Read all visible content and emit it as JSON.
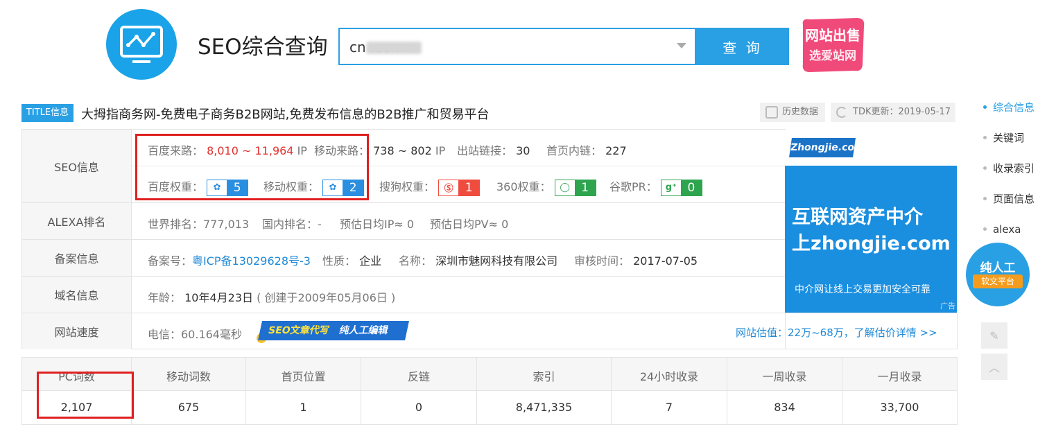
{
  "header": {
    "title": "SEO综合查询",
    "search_value": "cn          .com",
    "search_button": "查 询",
    "sale_badge_line1": "网站出售",
    "sale_badge_line2": "选爱站网"
  },
  "title_row": {
    "tag": "TITLE信息",
    "text": "大拇指商务网-免费电子商务B2B网站,免费发布信息的B2B推广和贸易平台",
    "history_button": "历史数据",
    "tdk_update": "TDK更新：2019-05-17"
  },
  "seo": {
    "label": "SEO信息",
    "baidu_traffic_label": "百度来路：",
    "baidu_traffic_value": "8,010 ~ 11,964",
    "baidu_traffic_unit": "IP",
    "mobile_traffic_label": "移动来路：",
    "mobile_traffic_value": "738 ~ 802",
    "mobile_traffic_unit": "IP",
    "outbound_label": "出站链接：",
    "outbound_value": "30",
    "inner_label": "首页内链：",
    "inner_value": "227",
    "baidu_weight_label": "百度权重：",
    "baidu_weight": "5",
    "mobile_weight_label": "移动权重：",
    "mobile_weight": "2",
    "sogou_weight_label": "搜狗权重：",
    "sogou_weight": "1",
    "w360_label": "360权重：",
    "w360": "1",
    "google_pr_label": "谷歌PR：",
    "google_pr": "0"
  },
  "alexa": {
    "label": "ALEXA排名",
    "world": "世界排名：777,013",
    "domestic": "国内排名：-",
    "daily_ip": "预估日均IP≈ 0",
    "daily_pv": "预估日均PV≈ 0"
  },
  "icp": {
    "label": "备案信息",
    "number_label": "备案号：",
    "number": "粤ICP备13029628号-3",
    "nature_label": "性质：",
    "nature": "企业",
    "name_label": "名称：",
    "name": "深圳市魅网科技有限公司",
    "audit_label": "审核时间：",
    "audit": "2017-07-05"
  },
  "domain": {
    "label": "域名信息",
    "age_label": "年龄：",
    "age": "10年4月23日",
    "created": "( 创建于2009年05月06日 )"
  },
  "speed": {
    "label": "网站速度",
    "telecom": "电信：60.164毫秒",
    "promo_a": "SEO文章代写",
    "promo_b": "纯人工编辑",
    "valuation": "网站估值：22万~68万，了解估价详情 >>"
  },
  "ad": {
    "logo": "Zhongjie.com",
    "line1": "互联网资产中介",
    "line2": "上zhongjie.com",
    "sub": "中介网让线上交易更加安全可靠",
    "tag": "广告"
  },
  "stats": {
    "headers": [
      "PC词数",
      "移动词数",
      "首页位置",
      "反链",
      "索引",
      "24小时收录",
      "一周收录",
      "一月收录"
    ],
    "values": [
      "2,107",
      "675",
      "1",
      "0",
      "8,471,335",
      "7",
      "834",
      "33,700"
    ]
  },
  "right_nav": {
    "items": [
      "综合信息",
      "关键词",
      "收录索引",
      "页面信息",
      "alexa"
    ],
    "robot_line1": "纯人工",
    "robot_line2": "软文平台"
  }
}
